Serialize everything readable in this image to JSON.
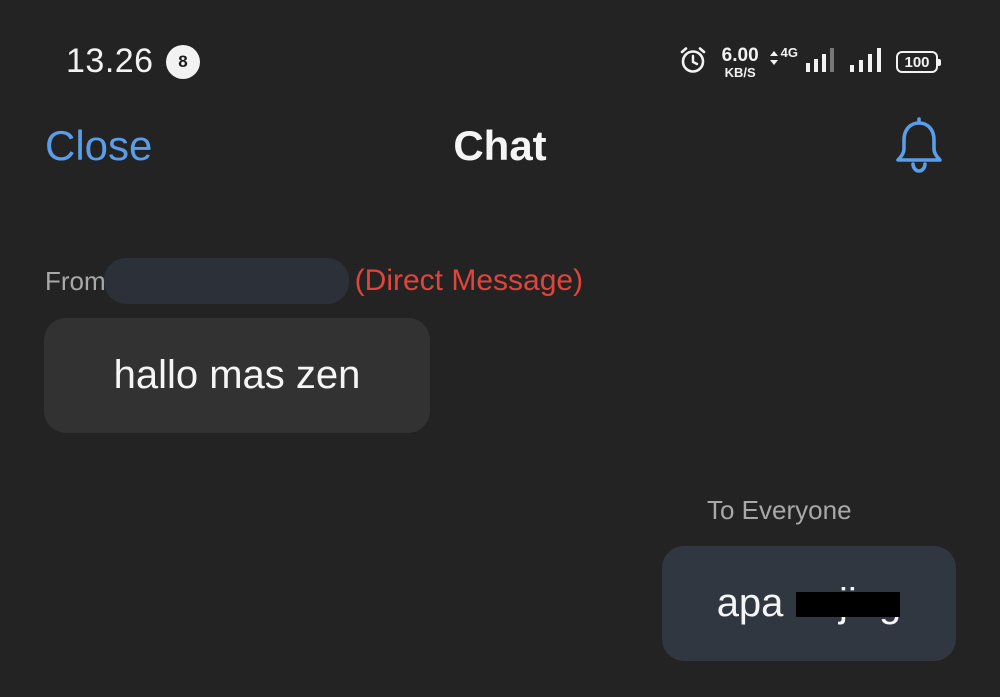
{
  "status_bar": {
    "time": "13.26",
    "notification_count": "8",
    "net_speed_value": "6.00",
    "net_speed_unit": "KB/S",
    "network_type": "4G",
    "battery": "100"
  },
  "header": {
    "close_label": "Close",
    "title": "Chat",
    "bell_icon": "bell-icon",
    "accent_color": "#5a9de8"
  },
  "messages": [
    {
      "direction": "incoming",
      "from_prefix": "From",
      "sender_name_redacted": true,
      "tag": "(Direct Message)",
      "tag_color": "#e0443a",
      "text": "hallo mas zen"
    },
    {
      "direction": "outgoing",
      "recipient_label": "To Everyone",
      "text": "apa anjing",
      "partially_redacted": true
    }
  ]
}
